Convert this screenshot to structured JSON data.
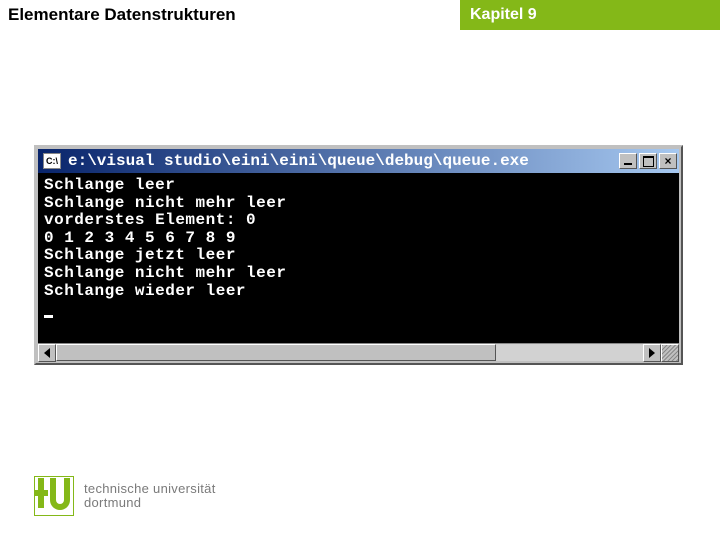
{
  "header": {
    "title": "Elementare Datenstrukturen",
    "chapter": "Kapitel 9"
  },
  "console": {
    "icon_label": "C:\\",
    "title_path": "e:\\visual studio\\eini\\eini\\queue\\debug\\queue.exe",
    "lines": [
      "Schlange leer",
      "Schlange nicht mehr leer",
      "vorderstes Element: 0",
      "0 1 2 3 4 5 6 7 8 9",
      "Schlange jetzt leer",
      "Schlange nicht mehr leer",
      "Schlange wieder leer"
    ]
  },
  "footer": {
    "line1": "technische universität",
    "line2": "dortmund"
  }
}
